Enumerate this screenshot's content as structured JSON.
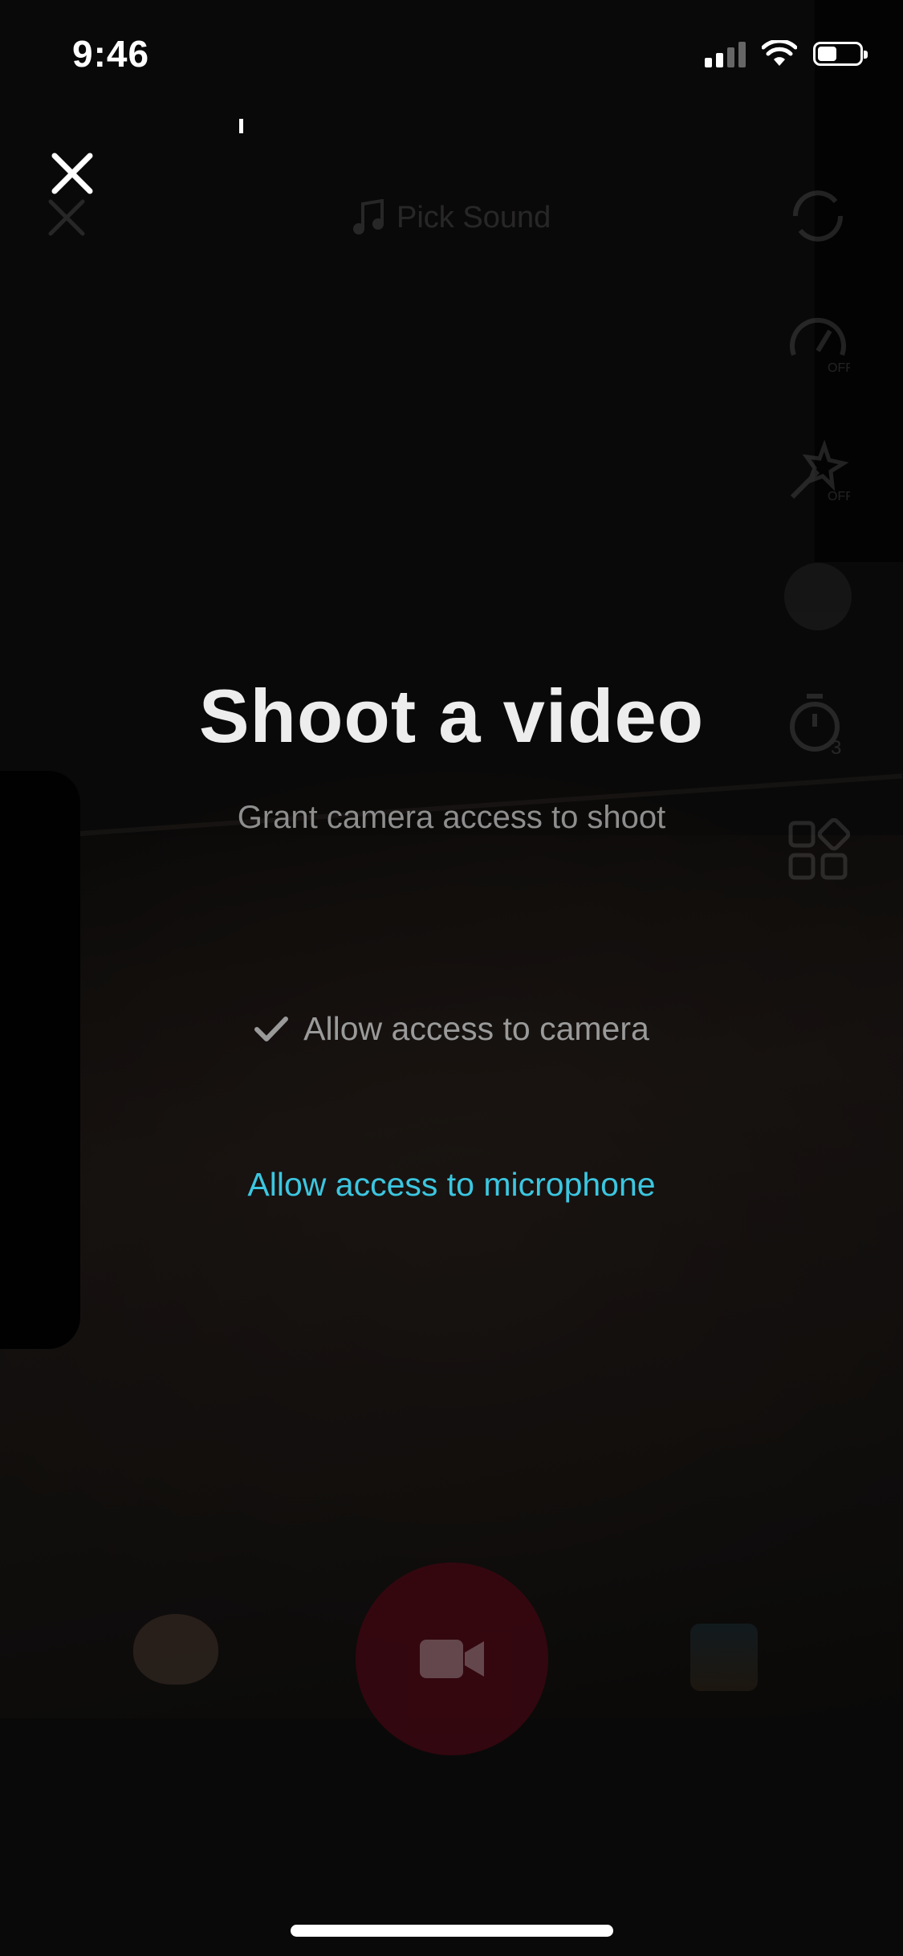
{
  "status_bar": {
    "time": "9:46",
    "signal_icon": "cellular-signal-icon",
    "wifi_icon": "wifi-icon",
    "battery_icon": "battery-icon",
    "battery_level": 0.45
  },
  "camera_ui": {
    "pick_sound_label": "Pick Sound",
    "speed_badge": "OFF",
    "beauty_badge": "OFF",
    "timer_badge": "3"
  },
  "permission_prompt": {
    "title": "Shoot a video",
    "subtitle": "Grant camera access to shoot",
    "camera_status": "Allow access to camera",
    "microphone_link": "Allow access to microphone"
  },
  "colors": {
    "link": "#3cc6e0",
    "record_button": "#3b0710"
  },
  "icons": {
    "close": "close-icon",
    "check": "checkmark-icon",
    "record": "video-camera-icon"
  }
}
